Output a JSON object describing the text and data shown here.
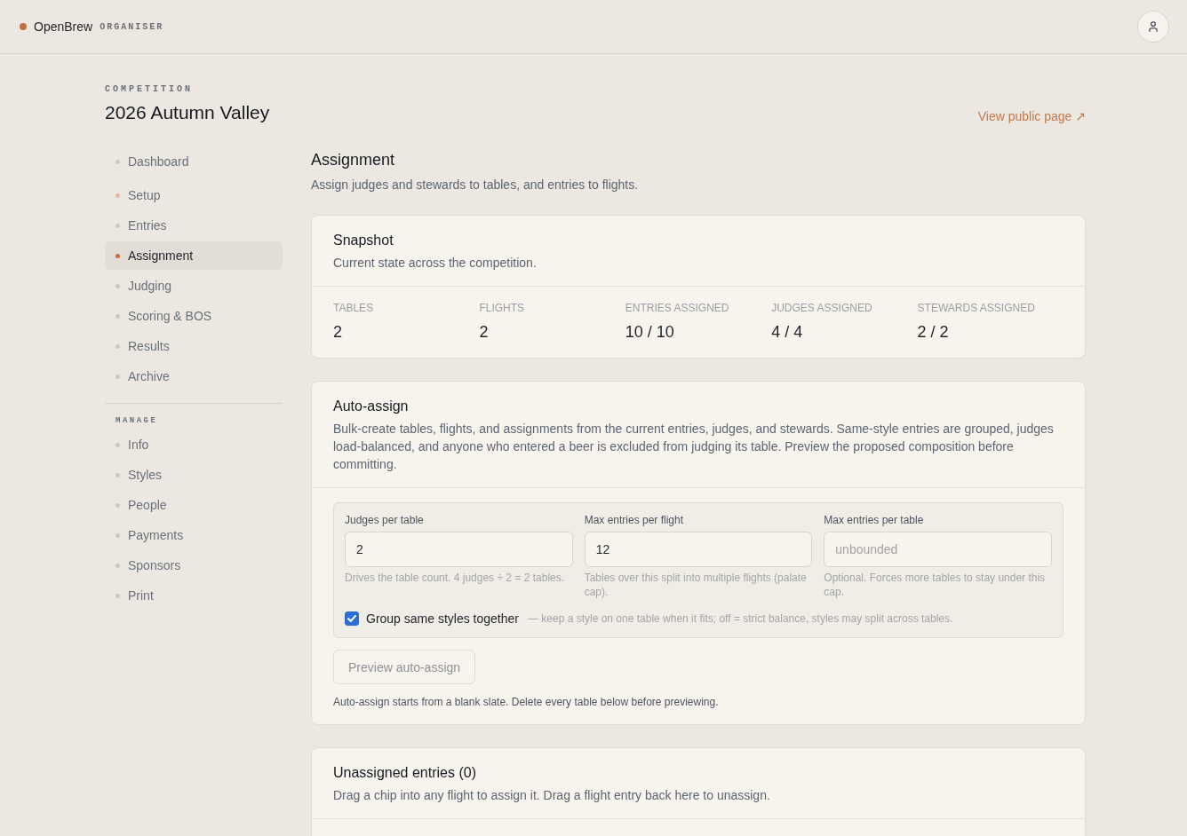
{
  "header": {
    "brand": "OpenBrew",
    "role": "ORGANISER"
  },
  "competition": {
    "eyebrow": "COMPETITION",
    "title": "2026 Autumn Valley",
    "public_link": "View public page ↗"
  },
  "sidebar": {
    "groups": [
      {
        "items": [
          {
            "label": "Dashboard",
            "selected": false,
            "color": "#cbc7c0"
          }
        ]
      },
      {
        "items": [
          {
            "label": "Setup",
            "selected": false,
            "color": "#e2bb9d"
          },
          {
            "label": "Entries",
            "selected": false,
            "color": "#cbc7c0"
          },
          {
            "label": "Assignment",
            "selected": true,
            "color": "#c0703f"
          },
          {
            "label": "Judging",
            "selected": false,
            "color": "#cbc7c0"
          },
          {
            "label": "Scoring & BOS",
            "selected": false,
            "color": "#cbc7c0"
          },
          {
            "label": "Results",
            "selected": false,
            "color": "#cbc7c0"
          },
          {
            "label": "Archive",
            "selected": false,
            "color": "#cbc7c0"
          }
        ]
      }
    ],
    "manage": {
      "heading": "MANAGE",
      "items": [
        {
          "label": "Info",
          "selected": false,
          "color": "#cbc7c0"
        },
        {
          "label": "Styles",
          "selected": false,
          "color": "#cbc7c0"
        },
        {
          "label": "People",
          "selected": false,
          "color": "#cbc7c0"
        },
        {
          "label": "Payments",
          "selected": false,
          "color": "#cbc7c0"
        },
        {
          "label": "Sponsors",
          "selected": false,
          "color": "#cbc7c0"
        },
        {
          "label": "Print",
          "selected": false,
          "color": "#cbc7c0"
        }
      ]
    }
  },
  "page": {
    "title": "Assignment",
    "subtitle": "Assign judges and stewards to tables, and entries to flights."
  },
  "snapshot": {
    "title": "Snapshot",
    "subtitle": "Current state across the competition.",
    "stats": [
      {
        "label": "TABLES",
        "value": "2"
      },
      {
        "label": "FLIGHTS",
        "value": "2"
      },
      {
        "label": "ENTRIES ASSIGNED",
        "value": "10 / 10"
      },
      {
        "label": "JUDGES ASSIGNED",
        "value": "4 / 4"
      },
      {
        "label": "STEWARDS ASSIGNED",
        "value": "2 / 2"
      }
    ]
  },
  "auto_assign": {
    "title": "Auto-assign",
    "description": "Bulk-create tables, flights, and assignments from the current entries, judges, and stewards. Same-style entries are grouped, judges load-balanced, and anyone who entered a beer is excluded from judging its table. Preview the proposed composition before committing.",
    "fields": [
      {
        "label": "Judges per table",
        "value": "2",
        "hint": "Drives the table count. 4 judges ÷ 2 = 2 tables."
      },
      {
        "label": "Max entries per flight",
        "value": "12",
        "hint": "Tables over this split into multiple flights (palate cap)."
      },
      {
        "label": "Max entries per table",
        "placeholder": "unbounded",
        "hint": "Optional. Forces more tables to stay under this cap."
      }
    ],
    "group_styles": {
      "label": "Group same styles together",
      "checked": true,
      "hint": "— keep a style on one table when it fits; off = strict balance, styles may split across tables."
    },
    "preview_button": {
      "label": "Preview auto-assign",
      "disabled": true
    },
    "note": "Auto-assign starts from a blank slate. Delete every table below before previewing."
  },
  "unassigned": {
    "title": "Unassigned entries (0)",
    "subtitle": "Drag a chip into any flight to assign it. Drag a flight entry back here to unassign."
  }
}
